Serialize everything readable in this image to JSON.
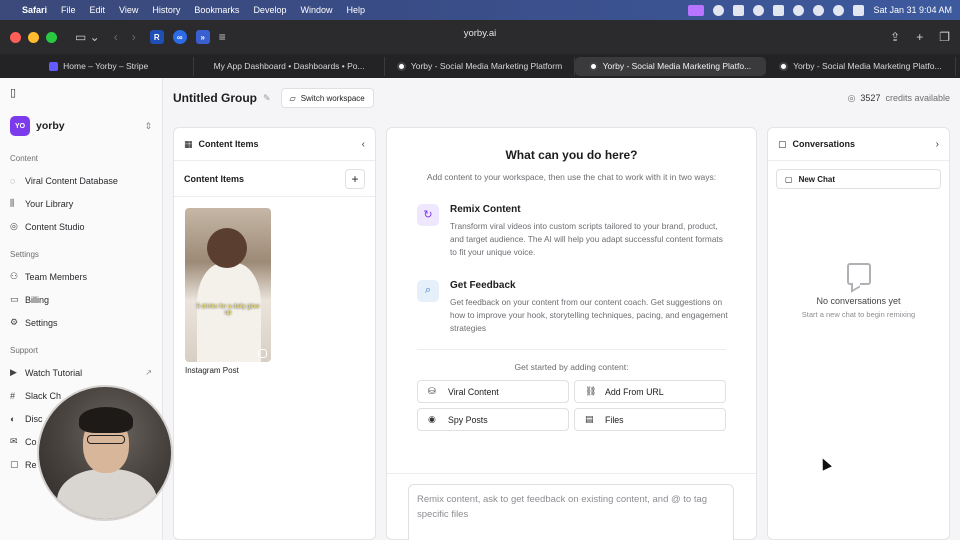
{
  "menubar": {
    "app": "Safari",
    "items": [
      "File",
      "Edit",
      "View",
      "History",
      "Bookmarks",
      "Develop",
      "Window",
      "Help"
    ],
    "datetime": "Sat Jan 31  9:04 AM"
  },
  "browser": {
    "url": "yorby.ai",
    "tabs": [
      {
        "title": "Home – Yorby – Stripe",
        "favicon": "stripe-icon"
      },
      {
        "title": "My App Dashboard • Dashboards • Po...",
        "favicon": "app-icon"
      },
      {
        "title": "Yorby - Social Media Marketing Platform",
        "favicon": "yorby-icon"
      },
      {
        "title": "Yorby - Social Media Marketing Platfo...",
        "favicon": "yorby-icon"
      },
      {
        "title": "Yorby - Social Media Marketing Platfo...",
        "favicon": "yorby-icon"
      }
    ],
    "active_tab": 3
  },
  "sidebar": {
    "workspace_badge": "YO",
    "workspace_name": "yorby",
    "sections": [
      {
        "title": "Content",
        "items": [
          {
            "label": "Viral Content Database",
            "icon": "bulb-icon"
          },
          {
            "label": "Your Library",
            "icon": "library-icon"
          },
          {
            "label": "Content Studio",
            "icon": "compass-icon"
          }
        ]
      },
      {
        "title": "Settings",
        "items": [
          {
            "label": "Team Members",
            "icon": "users-icon"
          },
          {
            "label": "Billing",
            "icon": "card-icon"
          },
          {
            "label": "Settings",
            "icon": "gear-icon"
          }
        ]
      },
      {
        "title": "Support",
        "items": [
          {
            "label": "Watch Tutorial",
            "icon": "play-icon"
          },
          {
            "label": "Slack Ch",
            "icon": "hash-icon"
          },
          {
            "label": "Disc",
            "icon": "discord-icon"
          },
          {
            "label": "Co",
            "icon": "mail-icon"
          },
          {
            "label": "Re",
            "icon": "chat-icon"
          }
        ]
      }
    ]
  },
  "header": {
    "group_title": "Untitled Group",
    "switch_label": "Switch workspace",
    "credits_value": "3527",
    "credits_label": "credits available"
  },
  "content_panel": {
    "title": "Content Items",
    "subtitle": "Content Items",
    "item_label": "Instagram Post",
    "item_caption": "5 drinks for a daily glow up"
  },
  "center": {
    "title": "What can you do here?",
    "subtitle": "Add content to your workspace, then use the chat to work with it in two ways:",
    "features": [
      {
        "title": "Remix Content",
        "desc": "Transform viral videos into custom scripts tailored to your brand, product, and target audience. The AI will help you adapt successful content formats to fit your unique voice.",
        "icon": "refresh-icon"
      },
      {
        "title": "Get Feedback",
        "desc": "Get feedback on your content from our content coach. Get suggestions on how to improve your hook, storytelling techniques, pacing, and engagement strategies",
        "icon": "search-icon"
      }
    ],
    "get_started": "Get started by adding content:",
    "actions": [
      {
        "label": "Viral Content",
        "icon": "database-icon"
      },
      {
        "label": "Add From URL",
        "icon": "link-icon"
      },
      {
        "label": "Spy Posts",
        "icon": "eye-icon"
      },
      {
        "label": "Files",
        "icon": "file-icon"
      }
    ],
    "chat_placeholder": "Remix content, ask to get feedback on existing content, and @ to tag specific files"
  },
  "conversations": {
    "title": "Conversations",
    "new_chat": "New Chat",
    "empty_title": "No conversations yet",
    "empty_sub": "Start a new chat to begin remixing"
  },
  "colors": {
    "accent": "#7c3aed"
  }
}
